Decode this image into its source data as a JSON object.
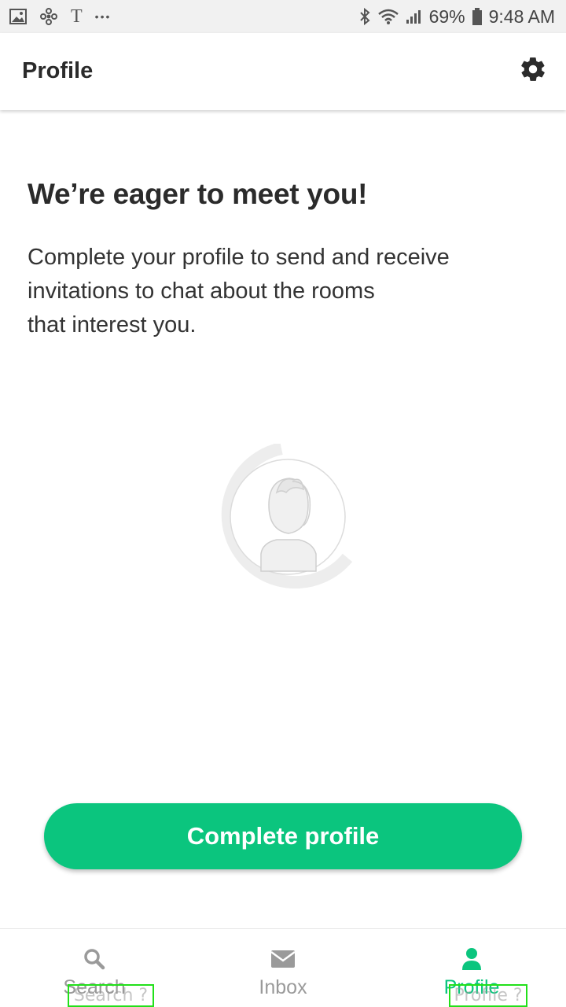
{
  "status_bar": {
    "left_icons": [
      "image-icon",
      "fan-icon",
      "t-icon",
      "more-dots-icon"
    ],
    "t_glyph": "T",
    "dots": "•••",
    "battery": "69%",
    "time": "9:48 AM"
  },
  "header": {
    "title": "Profile",
    "settings_icon": "gear-icon"
  },
  "content": {
    "headline": "We’re eager to meet you!",
    "description_lines": [
      "Complete your profile to send and receive",
      "invitations to chat about the rooms",
      "that interest you."
    ]
  },
  "button": {
    "label": "Complete profile"
  },
  "bottom_nav": {
    "items": [
      {
        "label": "Search",
        "icon": "search-icon",
        "active": false
      },
      {
        "label": "Inbox",
        "icon": "mail-icon",
        "active": false
      },
      {
        "label": "Profile",
        "icon": "person-icon",
        "active": true
      }
    ]
  },
  "hints": {
    "search": "Search ?",
    "profile": "Profile ?"
  },
  "colors": {
    "accent": "#0bc57e",
    "inactive": "#9a9a9a",
    "text": "#2b2b2b"
  }
}
